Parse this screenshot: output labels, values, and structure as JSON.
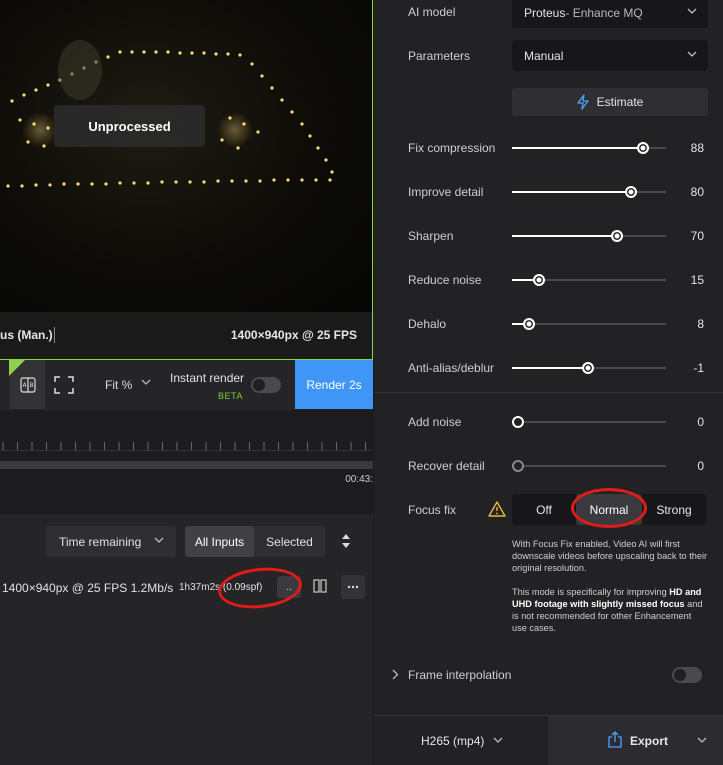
{
  "preview": {
    "overlay_label": "Unprocessed",
    "model_short": "us (Man.)",
    "resolution": "1400×940px @ 25 FPS"
  },
  "controls": {
    "fit_label": "Fit %",
    "instant_render_label": "Instant render",
    "beta_label": "BETA",
    "render_button": "Render 2s"
  },
  "timeline": {
    "timecode": "00:43:"
  },
  "queue": {
    "time_select": "Time remaining",
    "filter_all": "All Inputs",
    "filter_selected": "Selected",
    "row": {
      "resolution": "1400×940px @ 25 FPS  1.2Mb/s",
      "time": "1h37m2s (0.09spf)",
      "more": ".."
    }
  },
  "panel": {
    "ai_model_label": "AI model",
    "ai_model_value": "Proteus",
    "ai_model_sub": " - Enhance MQ",
    "parameters_label": "Parameters",
    "parameters_value": "Manual",
    "estimate": "Estimate",
    "sliders": [
      {
        "label": "Fix compression",
        "value": "88",
        "level": 0.85
      },
      {
        "label": "Improve detail",
        "value": "80",
        "level": 0.775
      },
      {
        "label": "Sharpen",
        "value": "70",
        "level": 0.685
      },
      {
        "label": "Reduce noise",
        "value": "15",
        "level": 0.175
      },
      {
        "label": "Dehalo",
        "value": "8",
        "level": 0.11
      },
      {
        "label": "Anti-alias/deblur",
        "value": "-1",
        "level": 0.495
      },
      {
        "label": "Add noise",
        "value": "0",
        "level": 0.04
      },
      {
        "label": "Recover detail",
        "value": "0",
        "level": 0.04
      }
    ],
    "focus_fix_label": "Focus fix",
    "focus_fix_options": [
      "Off",
      "Normal",
      "Strong"
    ],
    "focus_fix_selected": "Normal",
    "note1": "With Focus Fix enabled, Video AI will first downscale videos before upscaling back to their original resolution.",
    "note2_a": "This mode is specifically for improving ",
    "note2_b": "HD and UHD footage with slightly missed focus",
    "note2_c": " and is not recommended for other Enhancement use cases.",
    "frame_interpolation": "Frame interpolation",
    "codec": "H265 (mp4)",
    "export": "Export"
  },
  "colors": {
    "accent_blue": "#3f96f7",
    "accent_green": "#8fd14f",
    "annotation_red": "#e31a1a",
    "warning_yellow": "#e8b93a"
  }
}
